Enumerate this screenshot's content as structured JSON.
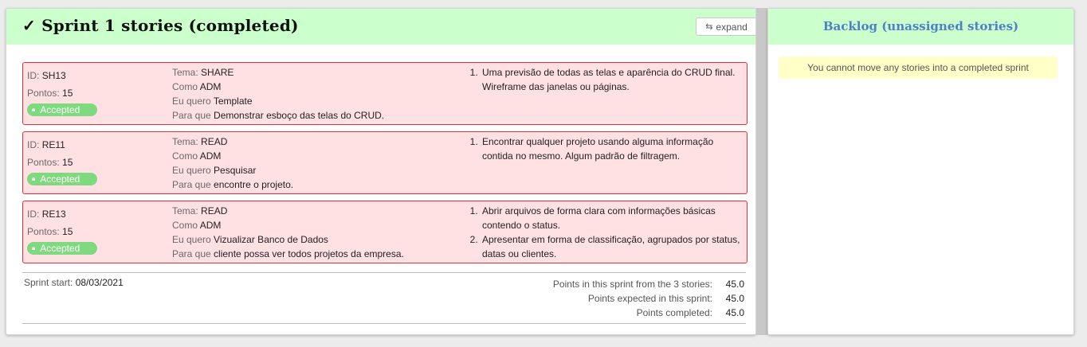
{
  "sprint": {
    "check_icon": "check-icon",
    "title": "✓ Sprint 1 stories (completed)",
    "expand_label": "expand",
    "expand_icon": "⇆"
  },
  "labels": {
    "id": "ID:",
    "points": "Pontos:",
    "theme": "Tema:",
    "as": "Como",
    "want": "Eu quero",
    "so_that": "Para que"
  },
  "stories": [
    {
      "id": "SH13",
      "points": "15",
      "status": "Accepted",
      "theme": "SHARE",
      "as": "ADM",
      "want": "Template",
      "so_that": "Demonstrar esboço das telas do CRUD.",
      "criteria": [
        "Uma previsão de todas as telas e aparência do CRUD final. Wireframe das janelas ou páginas."
      ]
    },
    {
      "id": "RE11",
      "points": "15",
      "status": "Accepted",
      "theme": "READ",
      "as": "ADM",
      "want": "Pesquisar",
      "so_that": "encontre o projeto.",
      "criteria": [
        "Encontrar qualquer projeto usando alguma informação contida no mesmo. Algum padrão de filtragem."
      ]
    },
    {
      "id": "RE13",
      "points": "15",
      "status": "Accepted",
      "theme": "READ",
      "as": "ADM",
      "want": "Vizualizar Banco de Dados",
      "so_that": "cliente possa ver todos projetos da empresa.",
      "criteria": [
        "Abrir arquivos de forma clara com informações básicas contendo o status.",
        "Apresentar em forma de classificação, agrupados por status, datas ou clientes."
      ]
    }
  ],
  "footer": {
    "start_label": "Sprint start:",
    "start_date": "08/03/2021",
    "stats": [
      {
        "label": "Points in this sprint from the 3 stories:",
        "value": "45.0"
      },
      {
        "label": "Points expected in this sprint:",
        "value": "45.0"
      },
      {
        "label": "Points completed:",
        "value": "45.0"
      }
    ]
  },
  "backlog": {
    "title": "Backlog (unassigned stories)",
    "notice": "You cannot move any stories into a completed sprint"
  },
  "colors": {
    "header_bg": "#cbffcb",
    "story_bg": "#ffe0e3",
    "story_border": "#e2303a",
    "accepted_badge": "#7fd97f",
    "backlog_title": "#4f7fc8",
    "notice_bg": "#ffffc7"
  }
}
